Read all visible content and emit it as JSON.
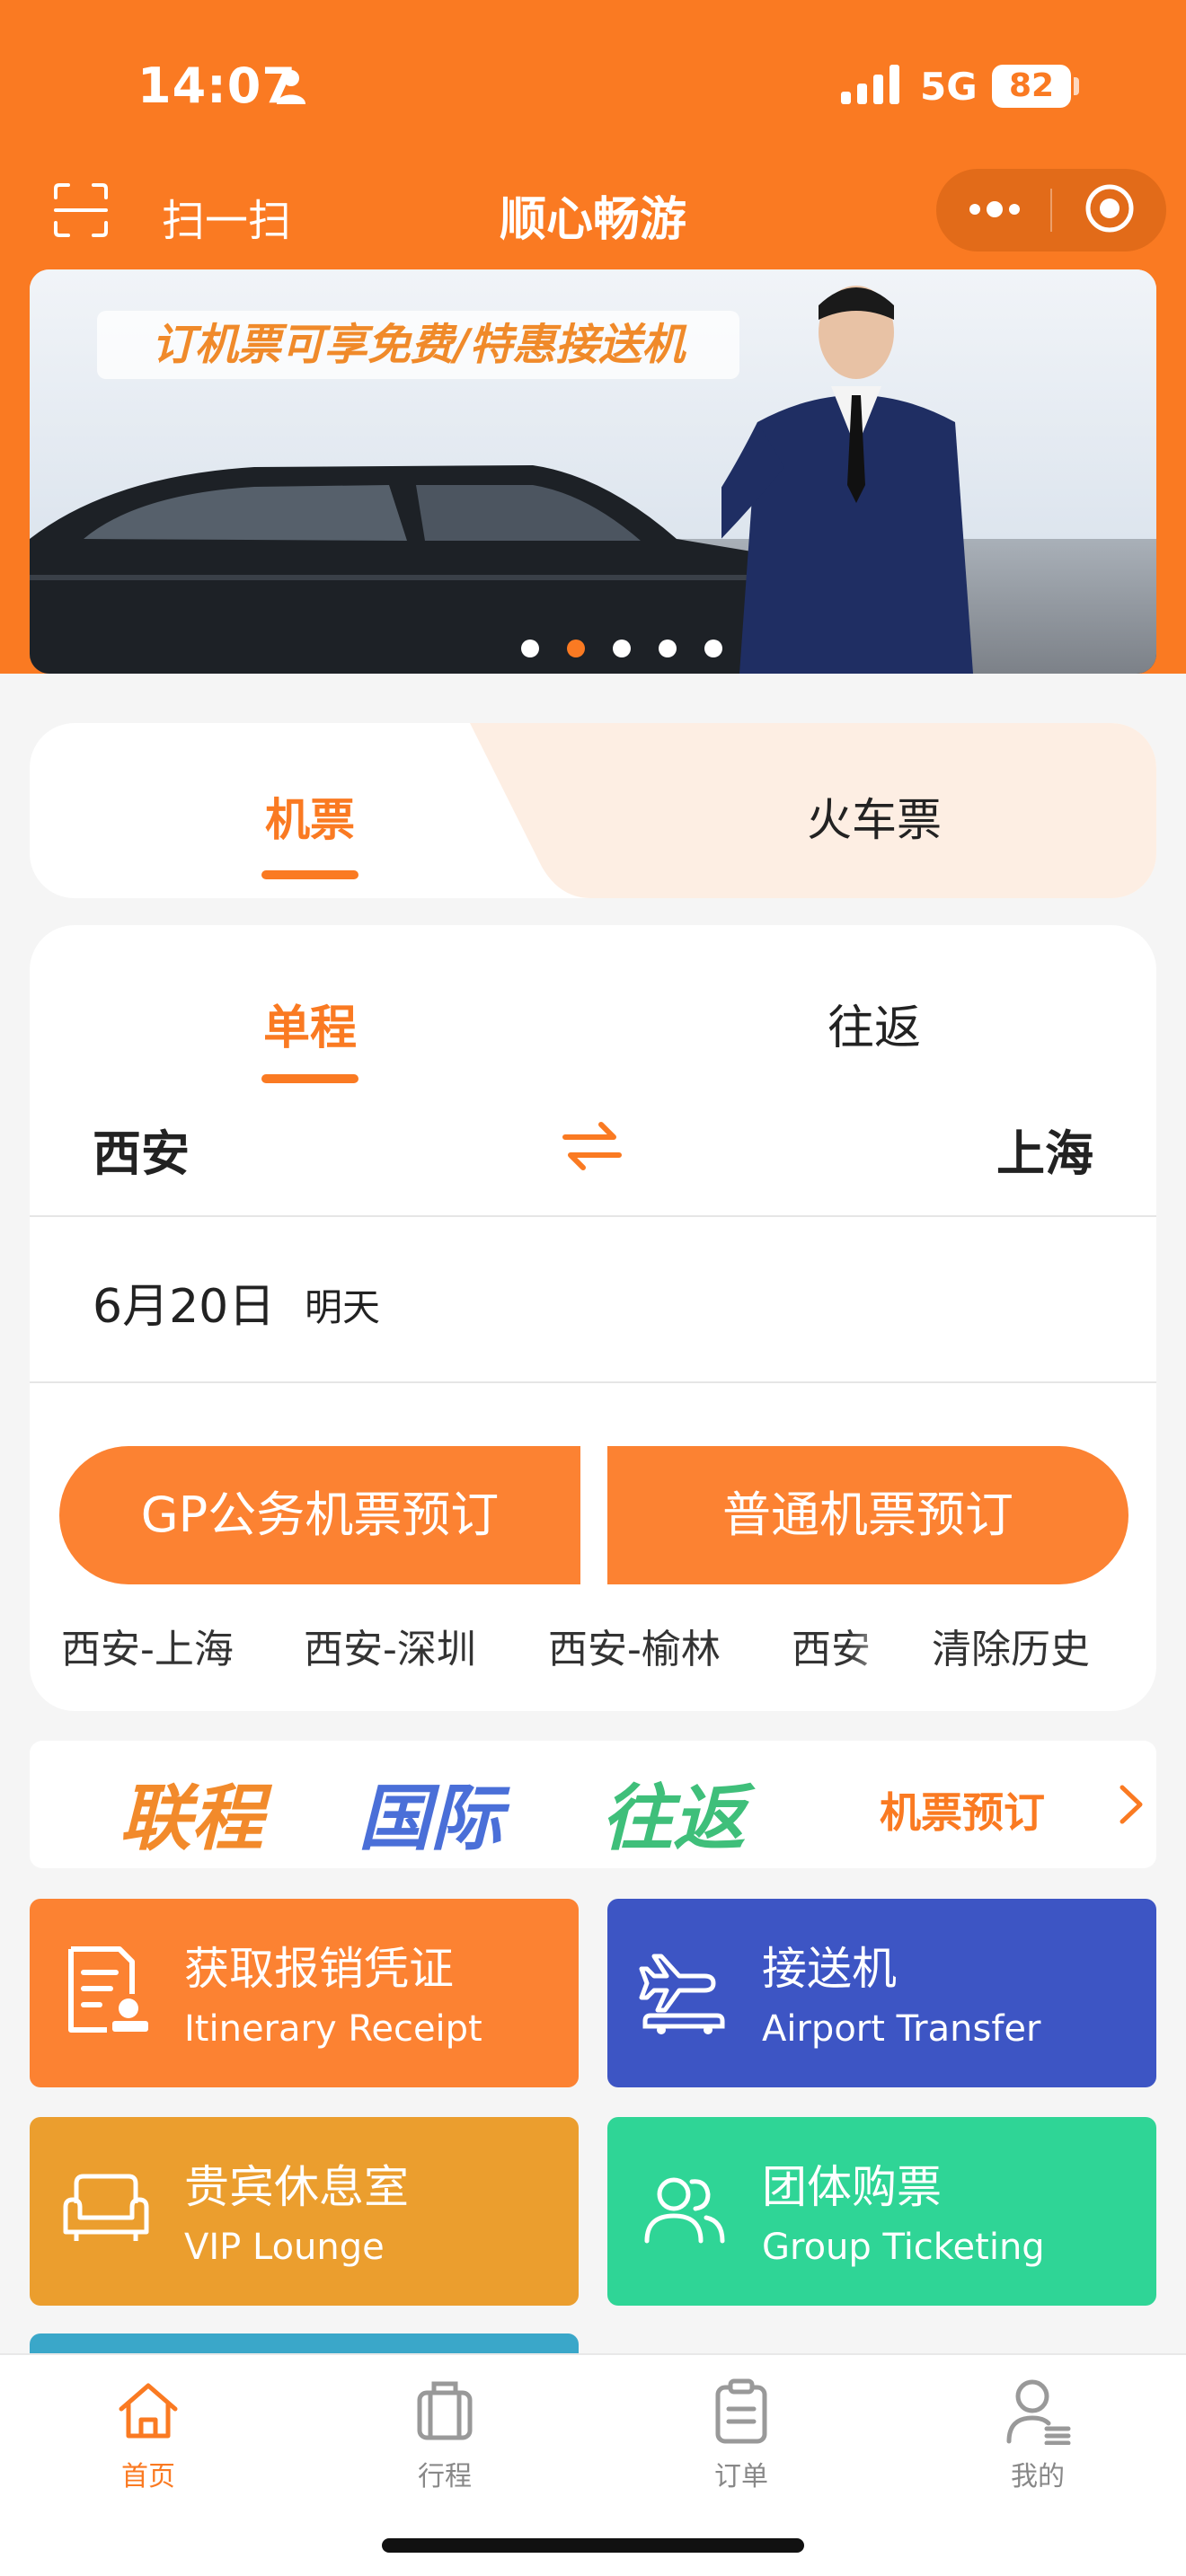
{
  "status_bar": {
    "time": "14:07",
    "network": "5G",
    "battery": "82"
  },
  "nav": {
    "scan_label": "扫一扫",
    "title": "顺心畅游"
  },
  "banner": {
    "caption": "订机票可享免费/特惠接送机",
    "slide_count": 5,
    "active_slide": 2
  },
  "mode_tabs": [
    {
      "label": "机票",
      "active": true
    },
    {
      "label": "火车票",
      "active": false
    }
  ],
  "booking": {
    "trip_tabs": [
      {
        "label": "单程",
        "active": true
      },
      {
        "label": "往返",
        "active": false
      }
    ],
    "from_city": "西安",
    "to_city": "上海",
    "date": "6月20日",
    "date_note": "明天",
    "buttons": {
      "gp": "GP公务机票预订",
      "normal": "普通机票预订"
    },
    "history": [
      "西安-上海",
      "西安-深圳",
      "西安-榆林",
      "西安"
    ],
    "clear_history": "清除历史"
  },
  "promo": {
    "words": [
      "联程",
      "国际",
      "往返"
    ],
    "link": "机票预订"
  },
  "tiles": [
    {
      "title": "获取报销凭证",
      "subtitle": "Itinerary Receipt",
      "color": "#fc8232",
      "icon": "receipt-icon"
    },
    {
      "title": "接送机",
      "subtitle": "Airport Transfer",
      "color": "#3d55c4",
      "icon": "airport-car-icon"
    },
    {
      "title": "贵宾休息室",
      "subtitle": "VIP Lounge",
      "color": "#eb9e2e",
      "icon": "sofa-icon"
    },
    {
      "title": "团体购票",
      "subtitle": "Group Ticketing",
      "color": "#2fd596",
      "icon": "group-icon"
    }
  ],
  "tab_bar": [
    {
      "label": "首页",
      "active": true
    },
    {
      "label": "行程",
      "active": false
    },
    {
      "label": "订单",
      "active": false
    },
    {
      "label": "我的",
      "active": false
    }
  ],
  "colors": {
    "brand_orange": "#fa7a22",
    "button_orange": "#fc8232"
  }
}
